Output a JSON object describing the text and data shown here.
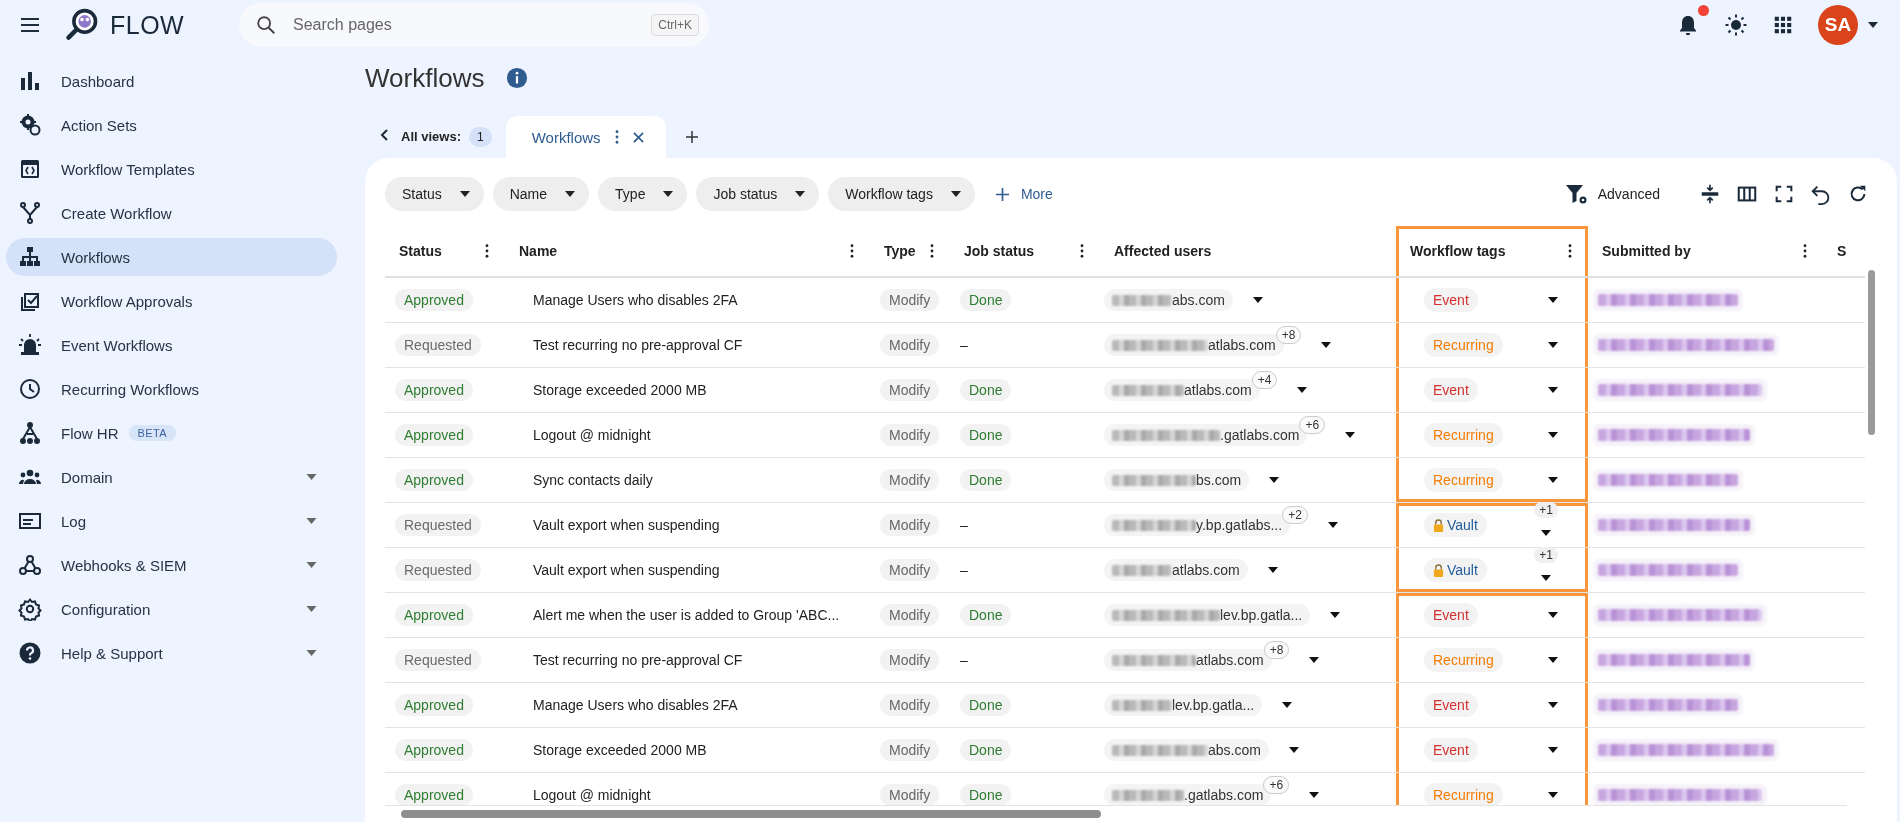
{
  "header": {
    "brand": "FLOW",
    "search": {
      "placeholder": "Search pages",
      "shortcut": "Ctrl+K"
    },
    "notifications": {
      "unread": true
    },
    "avatar": {
      "initials": "SA",
      "color": "#d9441a"
    }
  },
  "sidebar": {
    "items": [
      {
        "label": "Dashboard",
        "kind": "link",
        "selected": false
      },
      {
        "label": "Action Sets",
        "kind": "link",
        "selected": false
      },
      {
        "label": "Workflow Templates",
        "kind": "link",
        "selected": false
      },
      {
        "label": "Create Workflow",
        "kind": "link",
        "selected": false
      },
      {
        "label": "Workflows",
        "kind": "link",
        "selected": true
      },
      {
        "label": "Workflow Approvals",
        "kind": "link",
        "selected": false
      },
      {
        "label": "Event Workflows",
        "kind": "link",
        "selected": false
      },
      {
        "label": "Recurring Workflows",
        "kind": "link",
        "selected": false
      },
      {
        "label": "Flow HR",
        "kind": "link",
        "selected": false,
        "badge": "BETA"
      },
      {
        "label": "Domain",
        "kind": "group",
        "selected": false
      },
      {
        "label": "Log",
        "kind": "group",
        "selected": false
      },
      {
        "label": "Webhooks & SIEM",
        "kind": "group",
        "selected": false
      },
      {
        "label": "Configuration",
        "kind": "group",
        "selected": false
      },
      {
        "label": "Help & Support",
        "kind": "group",
        "selected": false
      }
    ]
  },
  "page": {
    "title": "Workflows",
    "views": {
      "label": "All views:",
      "count": "1"
    },
    "tabs": [
      {
        "label": "Workflows",
        "selected": true
      }
    ],
    "filters": [
      "Status",
      "Name",
      "Type",
      "Job status",
      "Workflow tags"
    ],
    "more": "More",
    "advanced": "Advanced"
  },
  "table": {
    "columns": [
      "Status",
      "Name",
      "Type",
      "Job status",
      "Affected users",
      "Workflow tags",
      "Submitted by",
      "S"
    ],
    "groups": [
      {
        "highlighted": true,
        "rows": [
          {
            "status": {
              "text": "Approved",
              "color": "#2e7d32"
            },
            "name": "Manage Users who disables 2FA",
            "type": "Modify",
            "job": {
              "text": "Done",
              "kind": "chip"
            },
            "user": {
              "text": "abs.com"
            },
            "tag": {
              "text": "Event",
              "color": "#d32f2f",
              "locked": false
            }
          },
          {
            "status": {
              "text": "Requested",
              "color": "#6b6b6b"
            },
            "name": "Test recurring no pre-approval CF",
            "type": "Modify",
            "job": {
              "text": "–",
              "kind": "plain"
            },
            "user": {
              "text": "atlabs.com",
              "extra": "+8"
            },
            "tag": {
              "text": "Recurring",
              "color": "#f57c00",
              "locked": false
            }
          },
          {
            "status": {
              "text": "Approved",
              "color": "#2e7d32"
            },
            "name": "Storage exceeded 2000 MB",
            "type": "Modify",
            "job": {
              "text": "Done",
              "kind": "chip"
            },
            "user": {
              "text": "atlabs.com",
              "extra": "+4"
            },
            "tag": {
              "text": "Event",
              "color": "#d32f2f",
              "locked": false
            }
          },
          {
            "status": {
              "text": "Approved",
              "color": "#2e7d32"
            },
            "name": "Logout @ midnight",
            "type": "Modify",
            "job": {
              "text": "Done",
              "kind": "chip"
            },
            "user": {
              "text": ".gatlabs.com",
              "extra": "+6"
            },
            "tag": {
              "text": "Recurring",
              "color": "#f57c00",
              "locked": false
            }
          },
          {
            "status": {
              "text": "Approved",
              "color": "#2e7d32"
            },
            "name": "Sync contacts daily",
            "type": "Modify",
            "job": {
              "text": "Done",
              "kind": "chip"
            },
            "user": {
              "text": "bs.com"
            },
            "tag": {
              "text": "Recurring",
              "color": "#f57c00",
              "locked": false
            }
          }
        ]
      },
      {
        "highlighted": true,
        "rows": [
          {
            "status": {
              "text": "Requested",
              "color": "#6b6b6b"
            },
            "name": "Vault export when suspending",
            "type": "Modify",
            "job": {
              "text": "–",
              "kind": "plain"
            },
            "user": {
              "text": "y.bp.gatlabs...",
              "extra": "+2"
            },
            "tag": {
              "text": "Vault",
              "color": "#1f5c99",
              "locked": true,
              "extra": "+1"
            }
          },
          {
            "status": {
              "text": "Requested",
              "color": "#6b6b6b"
            },
            "name": "Vault export when suspending",
            "type": "Modify",
            "job": {
              "text": "–",
              "kind": "plain"
            },
            "user": {
              "text": "atlabs.com"
            },
            "tag": {
              "text": "Vault",
              "color": "#1f5c99",
              "locked": true,
              "extra": "+1"
            }
          }
        ]
      },
      {
        "highlighted": true,
        "rows": [
          {
            "status": {
              "text": "Approved",
              "color": "#2e7d32"
            },
            "name": "Alert me when the user is added to Group 'ABC...",
            "type": "Modify",
            "job": {
              "text": "Done",
              "kind": "chip"
            },
            "user": {
              "text": "lev.bp.gatla..."
            },
            "tag": {
              "text": "Event",
              "color": "#d32f2f",
              "locked": false
            }
          },
          {
            "status": {
              "text": "Requested",
              "color": "#6b6b6b"
            },
            "name": "Test recurring no pre-approval CF",
            "type": "Modify",
            "job": {
              "text": "–",
              "kind": "plain"
            },
            "user": {
              "text": "atlabs.com",
              "extra": "+8"
            },
            "tag": {
              "text": "Recurring",
              "color": "#f57c00",
              "locked": false
            }
          },
          {
            "status": {
              "text": "Approved",
              "color": "#2e7d32"
            },
            "name": "Manage Users who disables 2FA",
            "type": "Modify",
            "job": {
              "text": "Done",
              "kind": "chip"
            },
            "user": {
              "text": "lev.bp.gatla..."
            },
            "tag": {
              "text": "Event",
              "color": "#d32f2f",
              "locked": false
            }
          },
          {
            "status": {
              "text": "Approved",
              "color": "#2e7d32"
            },
            "name": "Storage exceeded 2000 MB",
            "type": "Modify",
            "job": {
              "text": "Done",
              "kind": "chip"
            },
            "user": {
              "text": "abs.com"
            },
            "tag": {
              "text": "Event",
              "color": "#d32f2f",
              "locked": false
            }
          },
          {
            "status": {
              "text": "Approved",
              "color": "#2e7d32"
            },
            "name": "Logout @ midnight",
            "type": "Modify",
            "job": {
              "text": "Done",
              "kind": "chip"
            },
            "user": {
              "text": ".gatlabs.com",
              "extra": "+6"
            },
            "tag": {
              "text": "Recurring",
              "color": "#f57c00",
              "locked": false
            }
          }
        ]
      }
    ]
  }
}
